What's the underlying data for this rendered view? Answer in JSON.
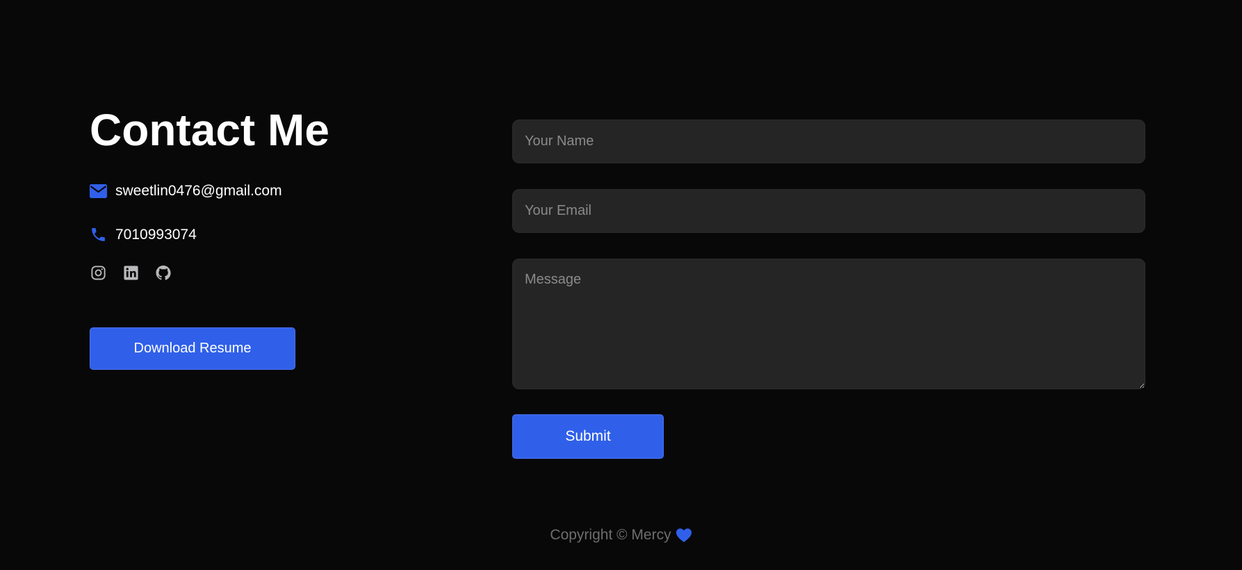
{
  "contact": {
    "title": "Contact Me",
    "email": "sweetlin0476@gmail.com",
    "phone": "7010993074",
    "email_icon": "envelope-icon",
    "phone_icon": "phone-icon",
    "socials": [
      {
        "name": "instagram-icon"
      },
      {
        "name": "linkedin-icon"
      },
      {
        "name": "github-icon"
      }
    ],
    "resume_label": "Download Resume"
  },
  "form": {
    "name_placeholder": "Your Name",
    "name_value": "",
    "email_placeholder": "Your Email",
    "email_value": "",
    "message_placeholder": "Message",
    "message_value": "",
    "submit_label": "Submit"
  },
  "footer": {
    "text": "Copyright © Mercy",
    "heart_icon": "heart-icon"
  },
  "colors": {
    "accent": "#3060ea",
    "background": "#080809",
    "field": "#252526",
    "footer_text": "#6d6d6f"
  }
}
